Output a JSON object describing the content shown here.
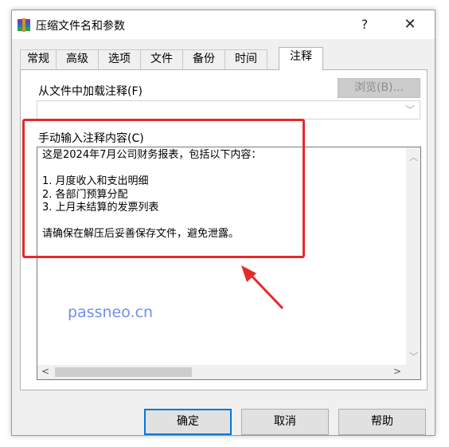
{
  "window": {
    "title": "压缩文件名和参数",
    "help_label": "?",
    "close_label": "✕"
  },
  "tabs": [
    {
      "label": "常规"
    },
    {
      "label": "高级"
    },
    {
      "label": "选项"
    },
    {
      "label": "文件"
    },
    {
      "label": "备份"
    },
    {
      "label": "时间"
    },
    {
      "label": "注释",
      "active": true
    }
  ],
  "load_comment": {
    "label": "从文件中加载注释(F)",
    "browse_label": "浏览(B)...",
    "file_value": ""
  },
  "manual_comment": {
    "label": "手动输入注释内容(C)",
    "lines": [
      "这是2024年7月公司财务报表，包括以下内容：",
      "",
      "1. 月度收入和支出明细",
      "2. 各部门预算分配",
      "3. 上月未结算的发票列表",
      "",
      "请确保在解压后妥善保存文件，避免泄露。"
    ]
  },
  "watermark": "passneo.cn",
  "buttons": {
    "ok": "确定",
    "cancel": "取消",
    "help": "帮助"
  },
  "colors": {
    "annotation": "#e8282a",
    "watermark": "#6f8ff0",
    "default_button_border": "#0078d7"
  }
}
